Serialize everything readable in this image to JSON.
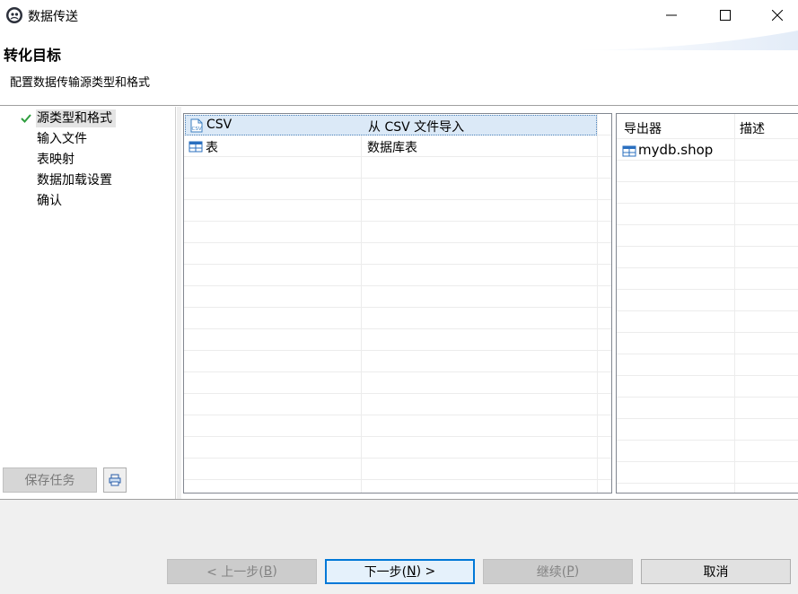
{
  "window": {
    "title": "数据传送",
    "app_icon": "app-logo-icon",
    "controls": [
      "minimize-icon",
      "maximize-icon",
      "close-icon"
    ]
  },
  "header": {
    "title": "转化目标",
    "description": "配置数据传输源类型和格式"
  },
  "steps": [
    {
      "label": "源类型和格式",
      "active": true,
      "completed": true
    },
    {
      "label": "输入文件",
      "active": false
    },
    {
      "label": "表映射",
      "active": false
    },
    {
      "label": "数据加载设置",
      "active": false
    },
    {
      "label": "确认",
      "active": false
    }
  ],
  "left_panel": {
    "save_task_label": "保存任务",
    "tool_icon": "print-tool-icon"
  },
  "source_types": [
    {
      "icon": "csv-file-icon",
      "name": "CSV",
      "description": "从 CSV 文件导入",
      "selected": true
    },
    {
      "icon": "table-icon",
      "name": "表",
      "description": "数据库表",
      "selected": false
    }
  ],
  "exporters": {
    "columns": [
      "导出器",
      "描述"
    ],
    "rows": [
      {
        "icon": "table-icon",
        "name": "mydb.shop",
        "description": ""
      }
    ]
  },
  "footer": {
    "prev_label": "< 上一步(",
    "prev_mnemonic": "B",
    "prev_tail": ")",
    "next_label": "下一步(",
    "next_mnemonic": "N",
    "next_tail": ") >",
    "continue_label": "继续(",
    "continue_mnemonic": "P",
    "continue_tail": ")",
    "cancel_label": "取消"
  },
  "colors": {
    "selection_bg": "#dbe9f7",
    "check_green": "#2e9e3e",
    "primary_border": "#0078d7"
  }
}
